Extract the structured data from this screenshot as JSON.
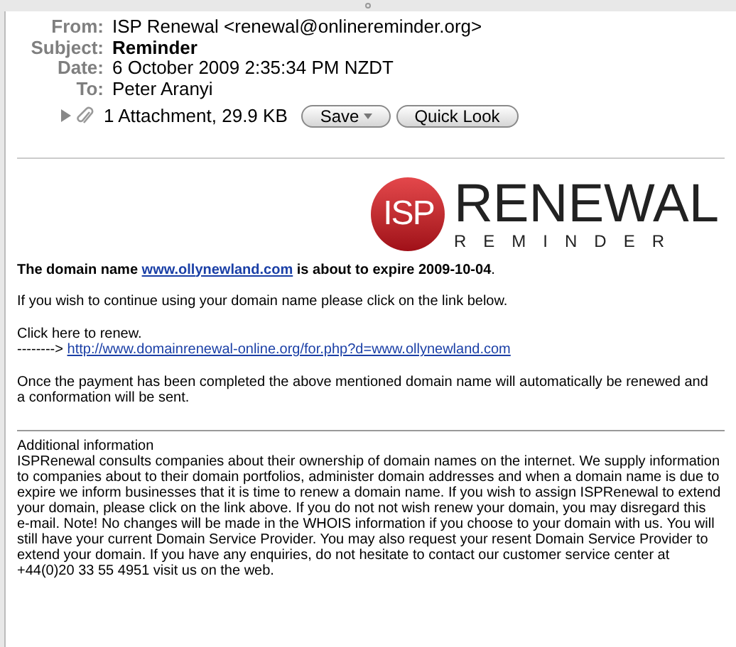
{
  "headers": [
    {
      "label": "From:",
      "value": "ISP Renewal <renewal@onlinereminder.org>",
      "bold": false
    },
    {
      "label": "Subject:",
      "value": "Reminder",
      "bold": true
    },
    {
      "label": "Date:",
      "value": "6 October 2009 2:35:34 PM NZDT",
      "bold": false
    },
    {
      "label": "To:",
      "value": "Peter Aranyi",
      "bold": false
    }
  ],
  "attachment": {
    "expanded": false,
    "summary": "1 Attachment, 29.9 KB",
    "buttons": [
      {
        "label": "Save",
        "kind": "menu"
      },
      {
        "label": "Quick Look",
        "kind": "plain"
      }
    ]
  },
  "logo": {
    "mark": "ISP",
    "title": "RENEWAL",
    "subtitle": "REMINDER"
  },
  "notice": {
    "prefix": "The domain name",
    "link": "www.ollynewland.com",
    "suffix": "is about to expire 2009-10-04",
    "end": "."
  },
  "intro": "If you wish to continue using your domain name please click on the link below.",
  "renew": {
    "label": "Click here to renew.",
    "arrow": "-------->",
    "link": "http://www.domainrenewal-online.org/for.php?d=www.ollynewland.com"
  },
  "confirmation": "Once the payment has been completed the above mentioned domain name will automatically be renewed and a conformation will  be sent.",
  "additional": {
    "title": "Additional information",
    "text": "ISPRenewal consults companies about their ownership of domain names on the internet. We supply information to companies about to their domain portfolios, administer domain addresses and when a domain name is due to expire we inform businesses that it is time to renew a domain name. If you wish to assign ISPRenewal to extend your domain, please click on the link above. If you do not not wish renew your domain, you may disregard this e-mail. Note! No changes will be made in the WHOIS information if you choose to your domain with us. You will still have your current Domain Service Provider. You may also request your resent Domain Service Provider to extend your domain. If you have any enquiries, do not hesitate to contact our customer service center at +44(0)20 33 55 4951 visit us on the web."
  }
}
